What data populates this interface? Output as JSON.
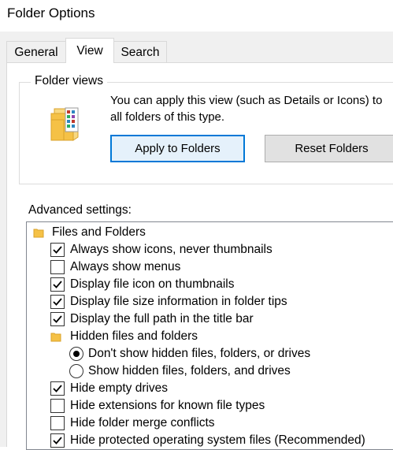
{
  "window": {
    "title": "Folder Options"
  },
  "tabs": [
    {
      "label": "General",
      "active": false
    },
    {
      "label": "View",
      "active": true
    },
    {
      "label": "Search",
      "active": false
    }
  ],
  "folder_views": {
    "group_label": "Folder views",
    "description_line1": "You can apply this view (such as Details or Icons) to",
    "description_line2": "all folders of this type.",
    "apply_button": "Apply to Folders",
    "reset_button": "Reset Folders"
  },
  "advanced": {
    "label": "Advanced settings:",
    "items": [
      {
        "type": "folder",
        "label": "Files and Folders"
      },
      {
        "type": "checkbox",
        "checked": true,
        "label": "Always show icons, never thumbnails"
      },
      {
        "type": "checkbox",
        "checked": false,
        "label": "Always show menus"
      },
      {
        "type": "checkbox",
        "checked": true,
        "label": "Display file icon on thumbnails"
      },
      {
        "type": "checkbox",
        "checked": true,
        "label": "Display file size information in folder tips"
      },
      {
        "type": "checkbox",
        "checked": true,
        "label": "Display the full path in the title bar"
      },
      {
        "type": "folder",
        "label": "Hidden files and folders"
      },
      {
        "type": "radio",
        "checked": true,
        "label": "Don't show hidden files, folders, or drives"
      },
      {
        "type": "radio",
        "checked": false,
        "label": "Show hidden files, folders, and drives"
      },
      {
        "type": "checkbox",
        "checked": true,
        "label": "Hide empty drives"
      },
      {
        "type": "checkbox",
        "checked": false,
        "label": "Hide extensions for known file types"
      },
      {
        "type": "checkbox",
        "checked": false,
        "label": "Hide folder merge conflicts"
      },
      {
        "type": "checkbox",
        "checked": true,
        "label": "Hide protected operating system files (Recommended)"
      }
    ]
  },
  "colors": {
    "accent": "#0078d7",
    "folder": "#f5c146",
    "dialog_bg": "#f0f0f0"
  }
}
